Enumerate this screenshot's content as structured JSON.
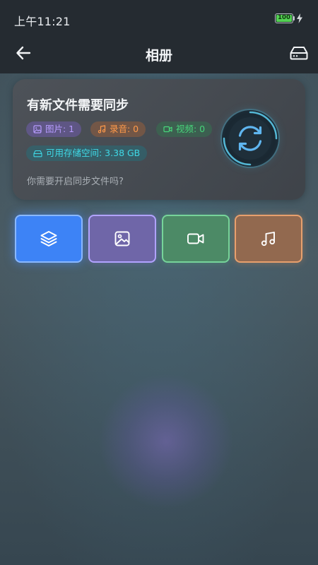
{
  "status_bar": {
    "time": "上午11:21",
    "battery": "100"
  },
  "app_bar": {
    "title": "相册",
    "back_icon": "arrow-left-icon",
    "action_icon": "hard-drive-icon"
  },
  "sync_card": {
    "title": "有新文件需要同步",
    "chips": {
      "images": "图片: 1",
      "recordings": "录音: 0",
      "videos": "视频: 0",
      "storage": "可用存储空间: 3.38 GB"
    },
    "question": "你需要开启同步文件吗?",
    "sync_icon": "sync-icon"
  },
  "categories": [
    {
      "name": "all",
      "icon": "layers-icon",
      "color": "#3d83f6"
    },
    {
      "name": "images",
      "icon": "image-icon",
      "color": "#6f66a8"
    },
    {
      "name": "videos",
      "icon": "video-icon",
      "color": "#4c8a66"
    },
    {
      "name": "audio",
      "icon": "music-icon",
      "color": "#92694f"
    }
  ]
}
